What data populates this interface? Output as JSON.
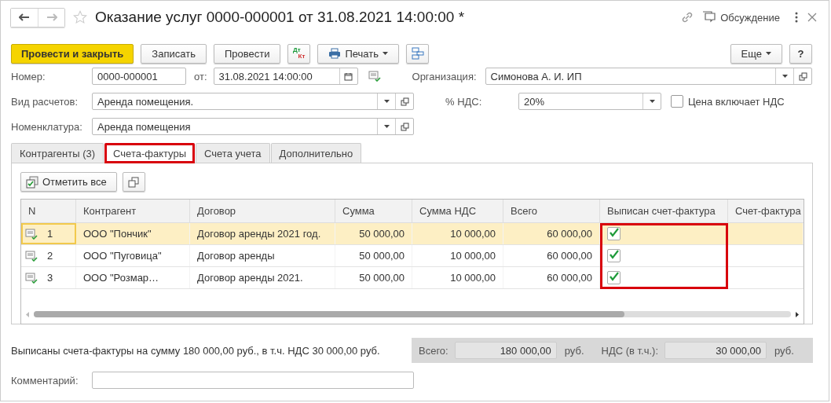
{
  "window": {
    "title": "Оказание услуг 0000-000001 от 31.08.2021 14:00:00 *",
    "favorite": false,
    "discussion": "Обсуждение"
  },
  "toolbar": {
    "left": [
      {
        "kind": "primary",
        "label": "Провести и закрыть"
      },
      {
        "kind": "button",
        "label": "Записать"
      },
      {
        "kind": "button",
        "label": "Провести"
      },
      {
        "kind": "dtkt",
        "label": "Дт",
        "label2": "Кт"
      },
      {
        "kind": "print",
        "label": "Печать"
      },
      {
        "kind": "structure"
      }
    ],
    "right": [
      {
        "kind": "menu",
        "label": "Еще"
      },
      {
        "kind": "button",
        "label": "?"
      }
    ]
  },
  "form": {
    "number": {
      "label": "Номер:",
      "value": "0000-000001"
    },
    "date": {
      "label": "от:",
      "value": "31.08.2021 14:00:00"
    },
    "organization": {
      "label": "Организация:",
      "value": "Симонова А. И. ИП"
    },
    "payment_type": {
      "label": "Вид расчетов:",
      "value": "Аренда помещения."
    },
    "vat_rate": {
      "label": "% НДС:",
      "value": "20%"
    },
    "price_includes_vat": {
      "label": "Цена включает НДС",
      "checked": false
    },
    "nomenclature": {
      "label": "Номенклатура:",
      "value": "Аренда помещения"
    }
  },
  "tabs": [
    {
      "label": "Контрагенты (3)",
      "selected": false,
      "highlighted": false
    },
    {
      "label": "Счета-фактуры",
      "selected": true,
      "highlighted": true
    },
    {
      "label": "Счета учета",
      "selected": false,
      "highlighted": false
    },
    {
      "label": "Дополнительно",
      "selected": false,
      "highlighted": false
    }
  ],
  "table_actions": {
    "mark_all": "Отметить все"
  },
  "table": {
    "columns": [
      {
        "label": "N",
        "kind": "text",
        "highlighted": false
      },
      {
        "label": "Контрагент",
        "kind": "text",
        "highlighted": false
      },
      {
        "label": "Договор",
        "kind": "text",
        "highlighted": false
      },
      {
        "label": "Сумма",
        "kind": "number",
        "highlighted": false
      },
      {
        "label": "Сумма НДС",
        "kind": "number",
        "highlighted": false
      },
      {
        "label": "Всего",
        "kind": "number",
        "highlighted": false
      },
      {
        "label": "Выписан счет-фактура",
        "kind": "check",
        "highlighted": true
      },
      {
        "label": "Счет-фактура",
        "kind": "text",
        "highlighted": false
      }
    ],
    "rows": [
      {
        "selected": true,
        "n": "1",
        "counterparty": "ООО \"Пончик\"",
        "contract": "Договор аренды 2021 год.",
        "sum": "50 000,00",
        "vat": "10 000,00",
        "total": "60 000,00",
        "invoiced": true
      },
      {
        "selected": false,
        "n": "2",
        "counterparty": "ООО \"Пуговица\"",
        "contract": "Договор аренды",
        "sum": "50 000,00",
        "vat": "10 000,00",
        "total": "60 000,00",
        "invoiced": true
      },
      {
        "selected": false,
        "n": "3",
        "counterparty": "ООО \"Розмар…",
        "contract": "Договор аренды 2021.",
        "sum": "50 000,00",
        "vat": "10 000,00",
        "total": "60 000,00",
        "invoiced": true
      }
    ]
  },
  "summary": {
    "text": "Выписаны счета-фактуры на сумму 180 000,00 руб., в т.ч. НДС 30 000,00 руб.",
    "total": {
      "label": "Всего:",
      "value": "180 000,00",
      "unit": "руб."
    },
    "vat": {
      "label": "НДС (в т.ч.):",
      "value": "30 000,00",
      "unit": "руб."
    }
  },
  "comment": {
    "label": "Комментарий:"
  }
}
